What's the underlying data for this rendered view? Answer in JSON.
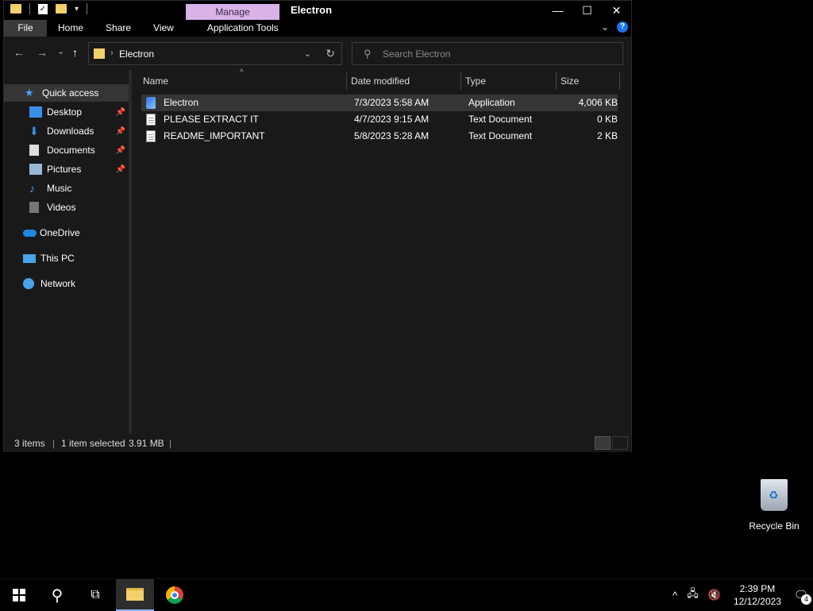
{
  "window": {
    "title": "Electron",
    "context_tab": "Manage",
    "ribbon_tabs": [
      "File",
      "Home",
      "Share",
      "View",
      "Application Tools"
    ],
    "controls": {
      "minimize": "—",
      "maximize": "☐",
      "close": "✕"
    },
    "help": "?"
  },
  "navigation": {
    "back": "←",
    "forward": "→",
    "recent": "⌄",
    "up": "↑",
    "address_path": "Electron",
    "search_placeholder": "Search Electron"
  },
  "sidebar": {
    "items": [
      {
        "label": "Quick access"
      },
      {
        "label": "Desktop"
      },
      {
        "label": "Downloads"
      },
      {
        "label": "Documents"
      },
      {
        "label": "Pictures"
      },
      {
        "label": "Music"
      },
      {
        "label": "Videos"
      },
      {
        "label": "OneDrive"
      },
      {
        "label": "This PC"
      },
      {
        "label": "Network"
      }
    ]
  },
  "columns": {
    "name": "Name",
    "date": "Date modified",
    "type": "Type",
    "size": "Size"
  },
  "files": [
    {
      "name": "Electron",
      "date": "7/3/2023 5:58 AM",
      "type": "Application",
      "size": "4,006 KB"
    },
    {
      "name": "PLEASE EXTRACT IT",
      "date": "4/7/2023 9:15 AM",
      "type": "Text Document",
      "size": "0 KB"
    },
    {
      "name": "README_IMPORTANT",
      "date": "5/8/2023 5:28 AM",
      "type": "Text Document",
      "size": "2 KB"
    }
  ],
  "status": {
    "count": "3 items",
    "selected": "1 item selected",
    "size": "3.91 MB"
  },
  "desktop": {
    "recycle_bin": "Recycle Bin"
  },
  "taskbar": {
    "time": "2:39 PM",
    "date": "12/12/2023",
    "notifications": "4"
  }
}
